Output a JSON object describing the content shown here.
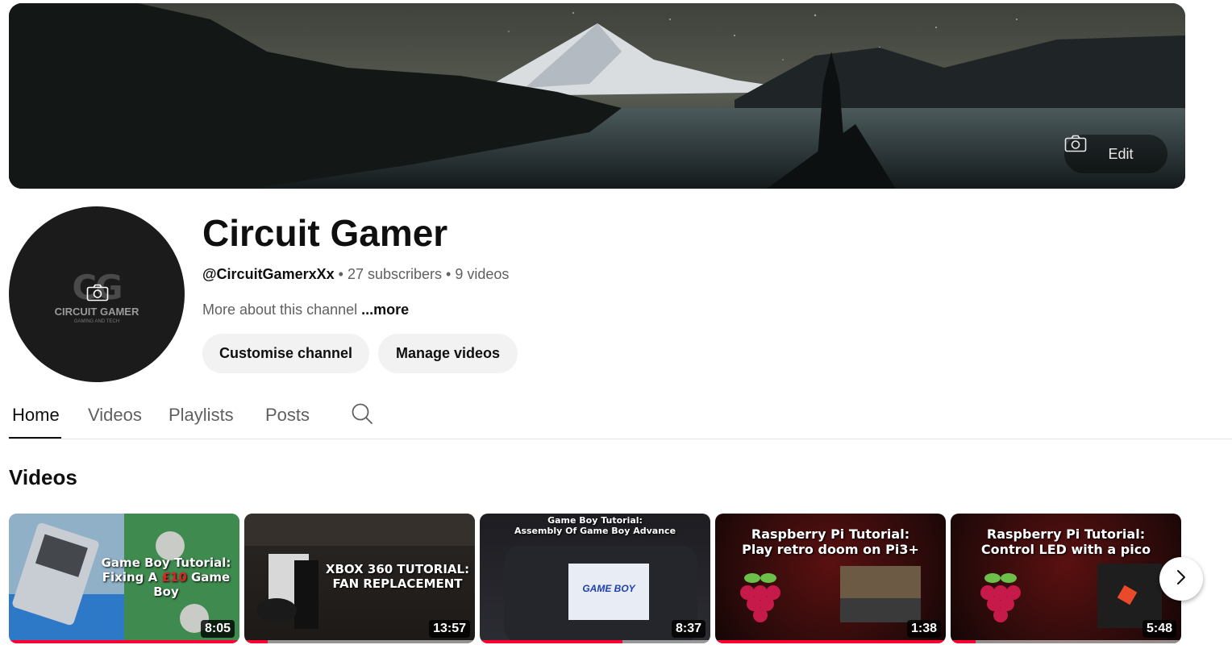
{
  "banner": {
    "edit_label": "Edit"
  },
  "avatar": {
    "initials": "CG",
    "name": "CIRCUIT GAMER",
    "tagline": "GAMING AND TECH"
  },
  "channel": {
    "title": "Circuit Gamer",
    "handle": "@CircuitGamerxXx",
    "subscribers": "27 subscribers",
    "videos_count": "9 videos",
    "separator": "•",
    "about_text": "More about this channel",
    "more_label": "...more"
  },
  "actions": {
    "customise": "Customise channel",
    "manage": "Manage videos"
  },
  "tabs": [
    {
      "label": "Home",
      "active": true
    },
    {
      "label": "Videos",
      "active": false
    },
    {
      "label": "Playlists",
      "active": false
    },
    {
      "label": "Posts",
      "active": false
    }
  ],
  "section": {
    "title": "Videos"
  },
  "videos": [
    {
      "caption": "Game Boy Tutorial: Fixing A £10 Game Boy",
      "duration": "8:05",
      "progress": 1.0
    },
    {
      "caption": "XBOX 360 TUTORIAL: FAN REPLACEMENT",
      "duration": "13:57",
      "progress": 0.1
    },
    {
      "caption": "Game Boy Tutorial: Assembly Of Game Boy Advance",
      "duration": "8:37",
      "progress": 0.62
    },
    {
      "caption": "Raspberry Pi Tutorial: Play retro doom on Pi3+",
      "duration": "1:38",
      "progress": 1.0
    },
    {
      "caption": "Raspberry Pi Tutorial: Control LED with a pico",
      "duration": "5:48",
      "progress": 0.11
    }
  ],
  "thumb_texts": {
    "gameboy": "GAME BOY",
    "gb1_line1": "Game Boy Tutorial:",
    "gb1_a": "Fixing A ",
    "gb1_price": "£10",
    "gb1_b": " Game Boy",
    "xb_line1": "XBOX 360 TUTORIAL:",
    "xb_line2": "FAN REPLACEMENT",
    "gba_line1": "Game Boy Tutorial:",
    "gba_line2": "Assembly Of Game Boy Advance",
    "rp1_line1": "Raspberry Pi Tutorial:",
    "rp1_line2": "Play retro doom on Pi3+",
    "rp2_line1": "Raspberry Pi Tutorial:",
    "rp2_line2": "Control LED with a pico"
  },
  "colors": {
    "progress": "#ff0033",
    "pill_bg": "#f2f2f2",
    "raspberry_bg": "#2a0a0a"
  }
}
